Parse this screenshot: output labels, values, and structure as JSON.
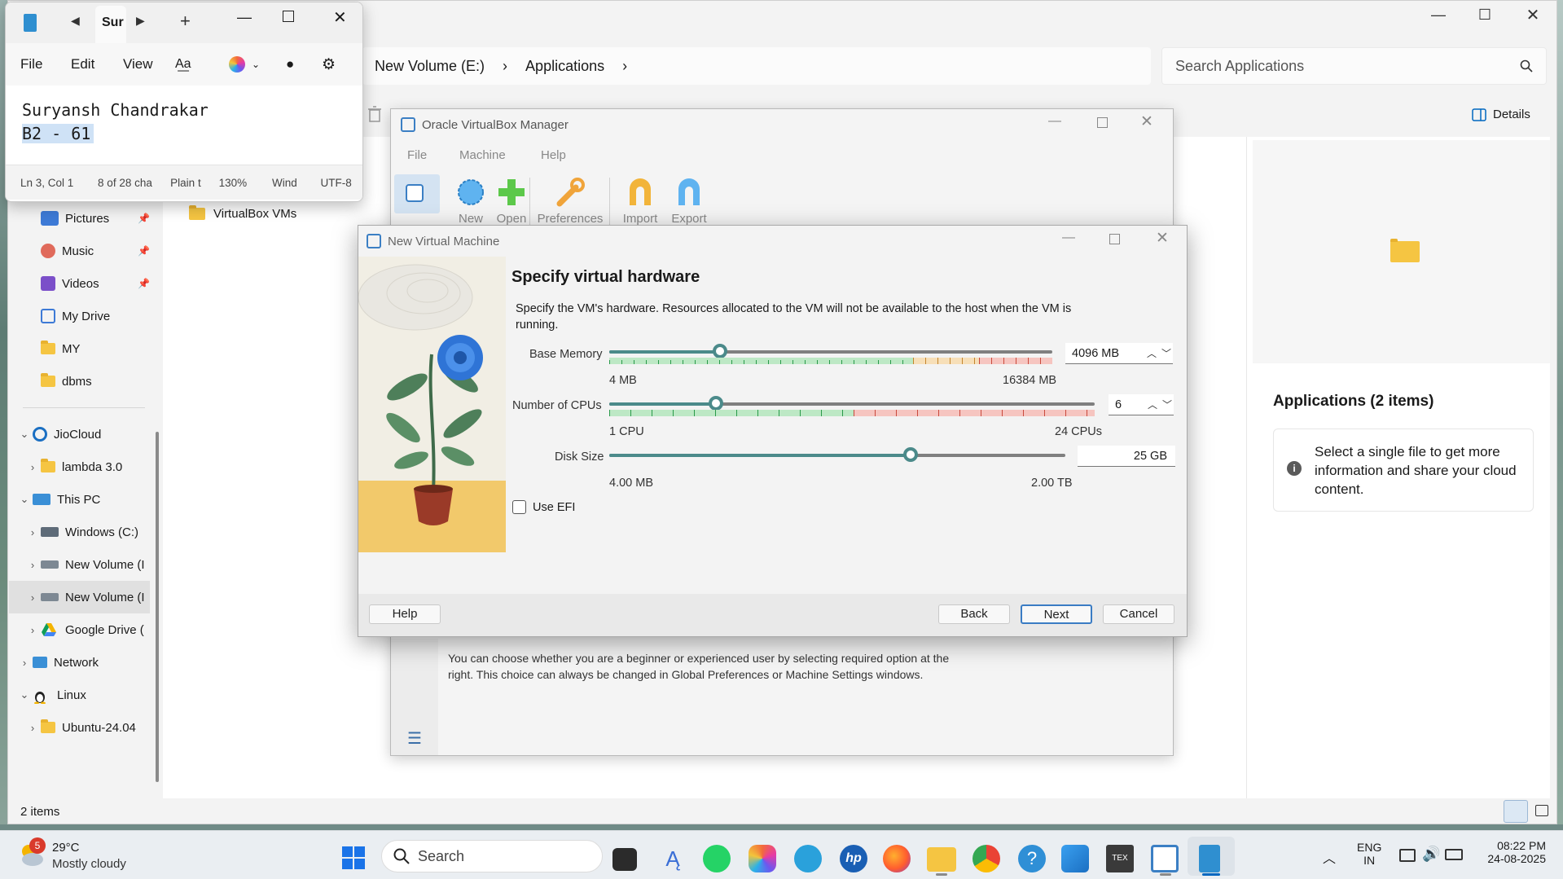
{
  "explorer": {
    "address": [
      "New Volume (E:)",
      "Applications"
    ],
    "search_placeholder": "Search Applications",
    "details_button": "Details",
    "folder_item": "VirtualBox VMs",
    "status_count": "2 items",
    "details_title": "Applications (2 items)",
    "details_info": "Select a single file to get more information and share your cloud content.",
    "nav": [
      {
        "label": "Pictures",
        "icon": "pictures-icon",
        "pinned": true
      },
      {
        "label": "Music",
        "icon": "music-icon",
        "pinned": true
      },
      {
        "label": "Videos",
        "icon": "videos-icon",
        "pinned": true
      },
      {
        "label": "My Drive",
        "icon": "drive-icon",
        "pinned": false
      },
      {
        "label": "MY",
        "icon": "folder-icon",
        "pinned": false
      },
      {
        "label": "dbms",
        "icon": "folder-icon",
        "pinned": false
      },
      {
        "label": "JioCloud",
        "icon": "cloud-icon",
        "expanded": true
      },
      {
        "label": "lambda 3.0",
        "icon": "folder-icon"
      },
      {
        "label": "This PC",
        "icon": "pc-icon",
        "expanded": true
      },
      {
        "label": "Windows (C:)",
        "icon": "drive-c-icon"
      },
      {
        "label": "New Volume (I",
        "icon": "disk-icon"
      },
      {
        "label": "New Volume (I",
        "icon": "disk-icon"
      },
      {
        "label": "Google Drive (",
        "icon": "google-drive-icon"
      },
      {
        "label": "Network",
        "icon": "network-icon"
      },
      {
        "label": "Linux",
        "icon": "linux-icon",
        "expanded": true
      },
      {
        "label": "Ubuntu-24.04",
        "icon": "folder-icon"
      }
    ]
  },
  "notepad": {
    "tab_title": "Sur",
    "menu": [
      "File",
      "Edit",
      "View"
    ],
    "lines": [
      "Suryansh Chandrakar",
      "B2 - 61"
    ],
    "status": [
      "Ln 3, Col 1",
      "8 of 28 cha",
      "Plain t",
      "130%",
      "Wind",
      "UTF-8"
    ]
  },
  "vbox_manager": {
    "title": "Oracle VirtualBox Manager",
    "menu": [
      "File",
      "Machine",
      "Help"
    ],
    "tools": [
      "New",
      "Open",
      "Preferences",
      "Import",
      "Export"
    ],
    "info_text": "You can choose whether you are a beginner or experienced user by selecting required option at the right. This choice can always be changed in Global Preferences or Machine Settings windows."
  },
  "new_vm": {
    "title": "New Virtual Machine",
    "heading": "Specify virtual hardware",
    "description": "Specify the VM's hardware. Resources allocated to the VM will not be available to the host when the VM is running.",
    "base_memory": {
      "label": "Base Memory",
      "value": "4096 MB",
      "min": "4 MB",
      "max": "16384 MB",
      "fraction": 0.25
    },
    "cpus": {
      "label": "Number of CPUs",
      "value": "6",
      "min": "1 CPU",
      "max": "24 CPUs",
      "fraction": 0.22
    },
    "disk": {
      "label": "Disk Size",
      "value": "25 GB",
      "min": "4.00 MB",
      "max": "2.00 TB",
      "fraction": 0.66
    },
    "use_efi": {
      "label": "Use EFI",
      "checked": false
    },
    "buttons": {
      "help": "Help",
      "back": "Back",
      "next": "Next",
      "cancel": "Cancel"
    }
  },
  "taskbar": {
    "weather_temp": "29°C",
    "weather_desc": "Mostly cloudy",
    "weather_badge": "5",
    "search": "Search",
    "lang": "ENG",
    "region": "IN",
    "time": "08:22 PM",
    "date": "24-08-2025"
  },
  "colors": {
    "accent": "#0067c0",
    "slider": "#4b8a8a",
    "green_zone": "#8fd19e",
    "red_zone": "#f2a6a0"
  }
}
